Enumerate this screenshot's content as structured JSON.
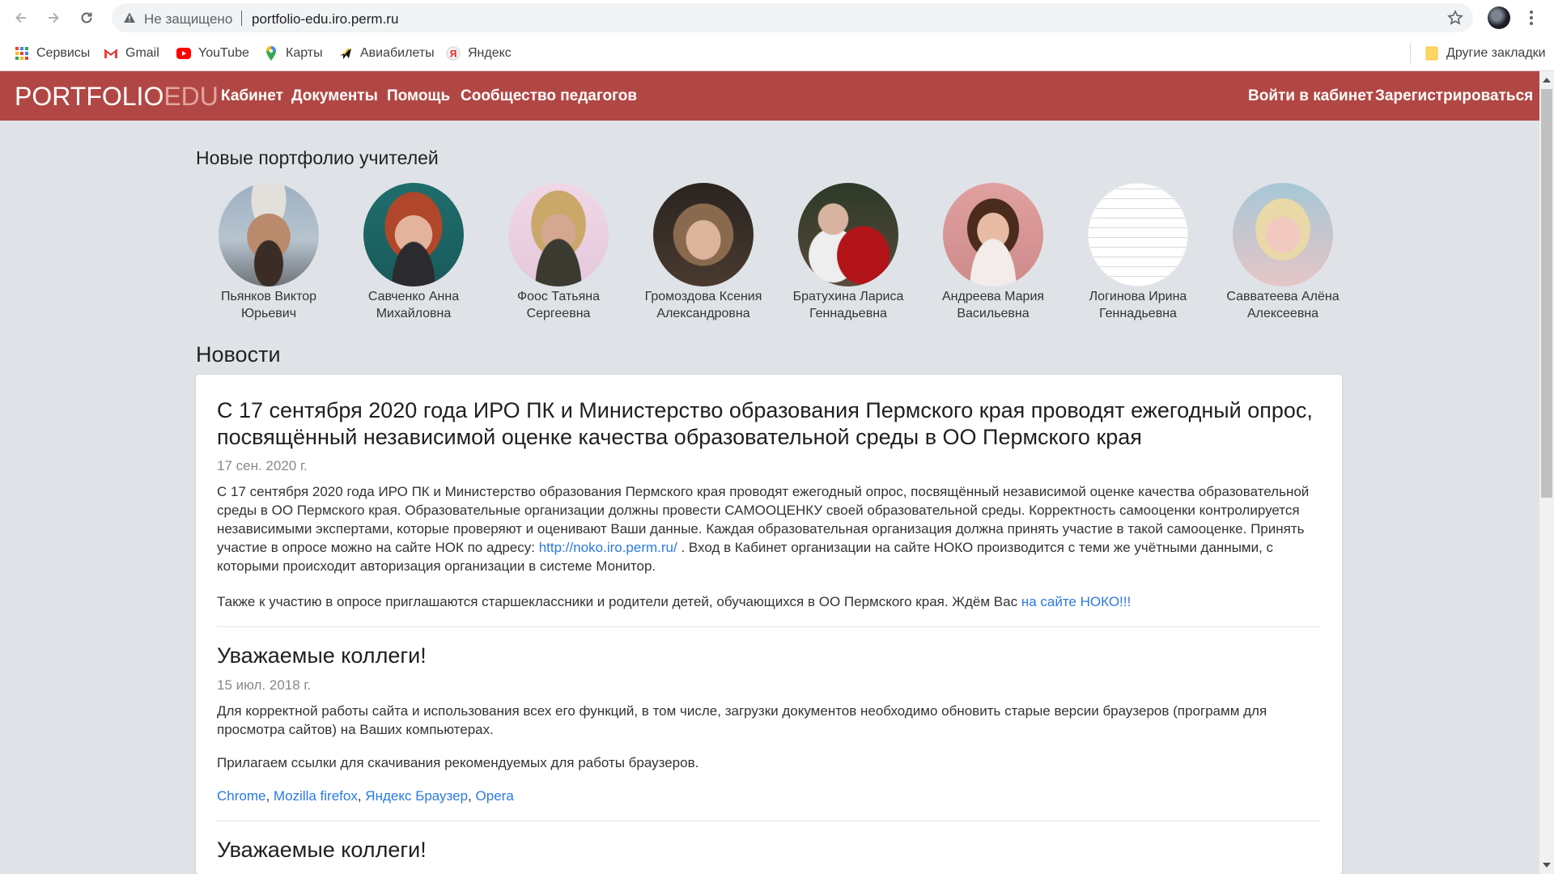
{
  "browser": {
    "security_text": "Не защищено",
    "url": "portfolio-edu.iro.perm.ru",
    "bookmarks": [
      {
        "label": "Сервисы",
        "icon": "apps-grid-icon"
      },
      {
        "label": "Gmail",
        "icon": "gmail-icon"
      },
      {
        "label": "YouTube",
        "icon": "youtube-icon"
      },
      {
        "label": "Карты",
        "icon": "maps-pin-icon"
      },
      {
        "label": "Авиабилеты",
        "icon": "airplane-icon"
      },
      {
        "label": "Яндекс",
        "icon": "yandex-icon"
      }
    ],
    "other_bookmarks": "Другие закладки"
  },
  "header": {
    "logo_main": "PORTFOLIO",
    "logo_accent": "EDU",
    "nav": [
      "Кабинет",
      "Документы",
      "Помощь",
      "Сообщество педагогов"
    ],
    "login": "Войти в кабинет",
    "register": "Зарегистрироваться",
    "bg_color": "#b14744"
  },
  "teachers_section": {
    "title": "Новые портфолио учителей",
    "teachers": [
      {
        "line1": "Пьянков Виктор",
        "line2": "Юрьевич"
      },
      {
        "line1": "Савченко Анна",
        "line2": "Михайловна"
      },
      {
        "line1": "Фоос Татьяна",
        "line2": "Сергеевна"
      },
      {
        "line1": "Громоздова Ксения",
        "line2": "Александровна"
      },
      {
        "line1": "Братухина Лариса",
        "line2": "Геннадьевна"
      },
      {
        "line1": "Андреева Мария",
        "line2": "Васильевна"
      },
      {
        "line1": "Логинова Ирина",
        "line2": "Геннадьевна"
      },
      {
        "line1": "Савватеева Алёна",
        "line2": "Алексеевна"
      }
    ]
  },
  "news_section": {
    "title": "Новости",
    "items": [
      {
        "title": "С 17 сентября 2020 года ИРО ПК и Министерство образования Пермского края проводят ежегодный опрос, посвящённый независимой оценке качества образовательной среды в ОО Пермского края",
        "date": "17 сен. 2020 г.",
        "body_before_link": "С 17 сентября 2020 года ИРО ПК и Министерство образования Пермского края проводят ежегодный опрос, посвящённый независимой оценке качества образовательной среды в ОО Пермского края. Образовательные организации должны провести САМООЦЕНКУ своей образовательной среды. Корректность самооценки контролируется независимыми экспертами, которые проверяют и оценивают Ваши данные. Каждая образовательная организация должна принять участие в такой самооценке. Принять участие в опросе можно на сайте НОК по адресу: ",
        "body_link": "http://noko.iro.perm.ru/",
        "body_after_link": " . Вход в Кабинет организации на сайте НОКО производится с теми же учётными данными, с которыми происходит авторизация организации в системе Монитор.",
        "para2_text": "Также к участию в опросе приглашаются старшеклассники и родители детей, обучающихся в ОО Пермского края. Ждём Вас ",
        "para2_link": "на сайте НОКО!!!"
      },
      {
        "title": "Уважаемые коллеги!",
        "date": "15 июл. 2018 г.",
        "para1": "Для корректной работы сайта и использования всех его функций, в том числе, загрузки документов необходимо обновить старые версии браузеров (программ для просмотра сайтов) на Ваших компьютерах.",
        "para2": "Прилагаем ссылки для скачивания рекомендуемых для работы браузеров.",
        "links": [
          "Chrome",
          "Mozilla firefox",
          "Яндекс Браузер",
          "Opera"
        ],
        "link_sep": ", "
      },
      {
        "title": "Уважаемые коллеги!"
      }
    ]
  }
}
